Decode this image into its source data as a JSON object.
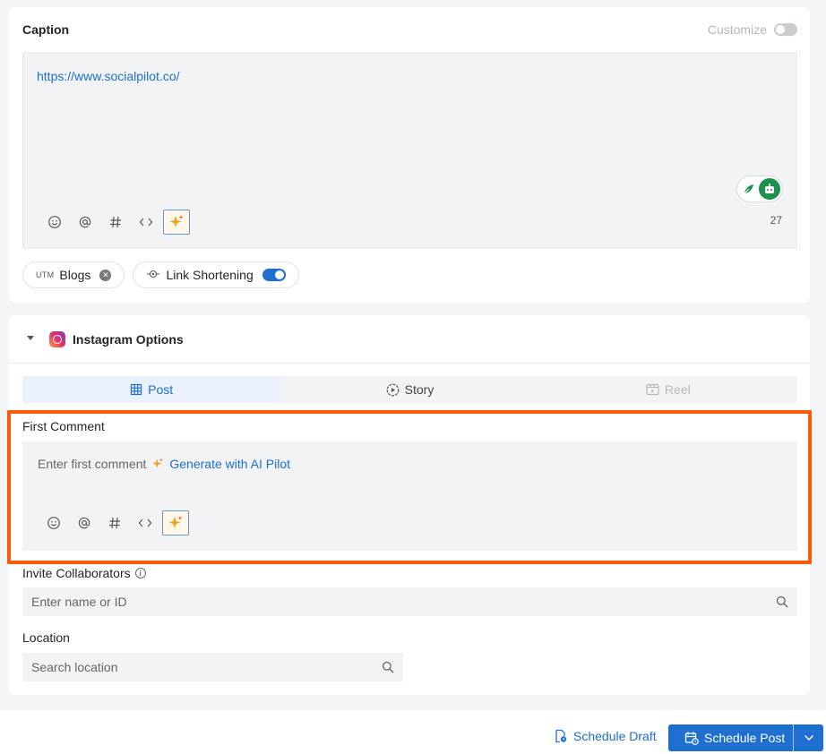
{
  "caption": {
    "title": "Caption",
    "customize_label": "Customize",
    "customize_enabled": false,
    "text": "https://www.socialpilot.co/",
    "char_count": "27",
    "toolbar_icons": [
      "emoji-icon",
      "mention-icon",
      "hashtag-icon",
      "code-icon",
      "ai-sparkle-icon"
    ],
    "chips": {
      "utm_tag": "UTM",
      "blogs_label": "Blogs",
      "link_shortening_label": "Link Shortening",
      "link_shortening_enabled": true
    }
  },
  "instagram": {
    "title": "Instagram Options",
    "tabs": [
      {
        "label": "Post",
        "active": true,
        "enabled": true
      },
      {
        "label": "Story",
        "active": false,
        "enabled": true
      },
      {
        "label": "Reel",
        "active": false,
        "enabled": false
      }
    ],
    "first_comment": {
      "label": "First Comment",
      "placeholder": "Enter first comment",
      "ai_link": "Generate with AI Pilot"
    },
    "invite": {
      "label": "Invite Collaborators",
      "placeholder": "Enter name or ID"
    },
    "location": {
      "label": "Location",
      "placeholder": "Search location"
    }
  },
  "footer": {
    "draft_label": "Schedule Draft",
    "schedule_label": "Schedule Post"
  },
  "colors": {
    "accent": "#1f6fd1",
    "highlight_border": "#fa5a0a",
    "grammar_green": "#1f8f4e"
  }
}
